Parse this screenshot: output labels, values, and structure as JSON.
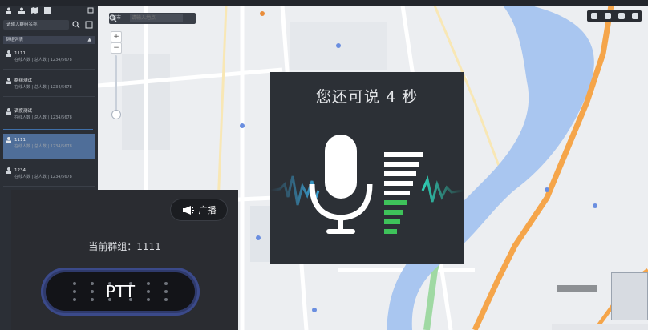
{
  "colors": {
    "water": "#a9c6f0",
    "road_major": "#f5a54a",
    "road_green": "#9fd9a3",
    "panel_bg": "#2a2c31",
    "ptt_ring": "#3b4a8a",
    "level_green": "#3ec25a"
  },
  "map": {
    "search_select": "城市",
    "search_placeholder": "请输入地点",
    "icons": [
      "search-icon",
      "zoom-in-icon",
      "zoom-out-icon"
    ]
  },
  "sidebar": {
    "search_value": "请输入群组名称",
    "group_header": "群组列表",
    "items": [
      {
        "name": "1111",
        "sub": "在线人数 | 总人数 | 1234/5678"
      },
      {
        "name": "群组测试",
        "sub": "在线人数 | 总人数 | 1234/5678"
      },
      {
        "name": "调度测试",
        "sub": "在线人数 | 总人数 | 1234/5678"
      },
      {
        "name": "1111",
        "sub": "在线人数 | 总人数 | 1234/5678"
      },
      {
        "name": "1234",
        "sub": "在线人数 | 总人数 | 1234/5678"
      }
    ]
  },
  "ptt_panel": {
    "broadcast_label": "广播",
    "current_group_label": "当前群组：",
    "current_group_value": "1111",
    "ptt_label": "PTT"
  },
  "voice_overlay": {
    "title": "您还可说 4 秒",
    "level_bars_total": 9,
    "level_bars_green": 4
  }
}
